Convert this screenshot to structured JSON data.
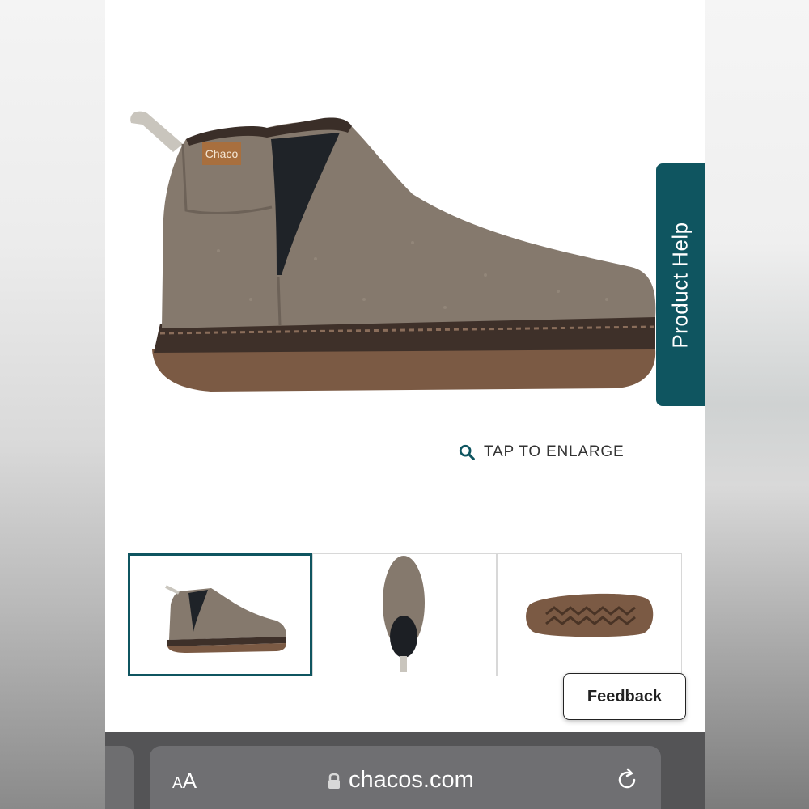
{
  "hero": {
    "brand_tag": "Chaco",
    "enlarge_label": "TAP TO ENLARGE",
    "enlarge_icon": "search-icon"
  },
  "help_tab": {
    "label": "Product Help"
  },
  "thumbnails": [
    {
      "view": "side",
      "selected": true
    },
    {
      "view": "top",
      "selected": false
    },
    {
      "view": "sole",
      "selected": false
    }
  ],
  "feedback": {
    "label": "Feedback"
  },
  "browser": {
    "text_size_small": "A",
    "text_size_large": "A",
    "domain": "chacos.com",
    "lock_icon": "lock-icon",
    "reload_icon": "reload-icon"
  },
  "colors": {
    "accent": "#0f5560",
    "boot_felt": "#85796d",
    "sole": "#7b5a44"
  }
}
